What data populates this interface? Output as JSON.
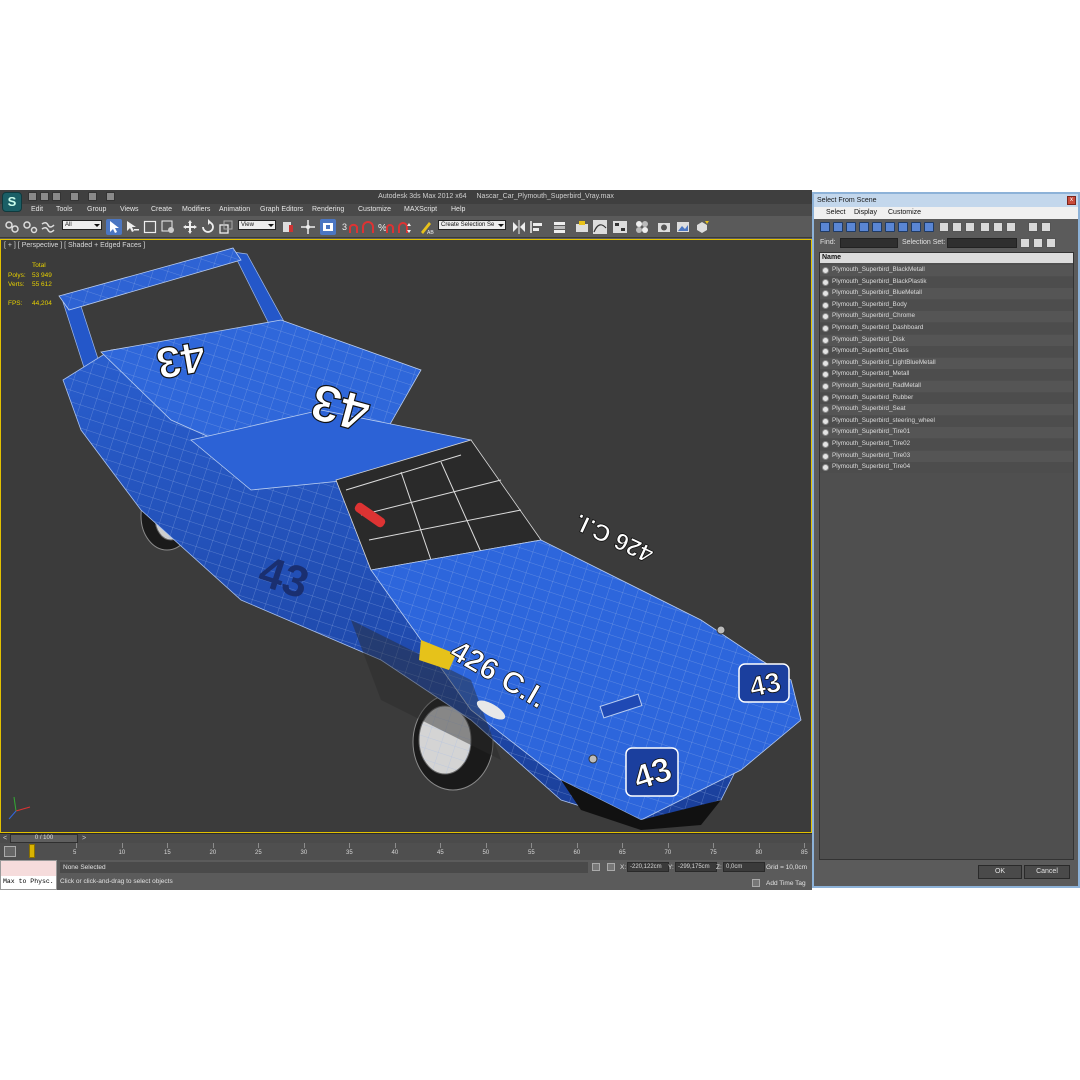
{
  "window": {
    "title": "Autodesk 3ds Max  2012 x64",
    "file": "Nascar_Car_Plymouth_Superbird_Vray.max"
  },
  "menu": [
    "Edit",
    "Tools",
    "Group",
    "Views",
    "Create",
    "Modifiers",
    "Animation",
    "Graph Editors",
    "Rendering",
    "Customize",
    "MAXScript",
    "Help"
  ],
  "toolbar": {
    "filter_value": "All",
    "ref_coord_value": "View",
    "selection_set_placeholder": "Create Selection Se"
  },
  "viewport": {
    "label": "[ + ] [ Perspective ] [ Shaded + Edged Faces ]",
    "stats": {
      "header": "Total",
      "polys_label": "Polys:",
      "polys_value": "53 949",
      "verts_label": "Verts:",
      "verts_value": "55 612",
      "fps_label": "FPS:",
      "fps_value": "44,204"
    },
    "car_texts": {
      "roof_number": "43",
      "wing_number": "43",
      "door_number": "43",
      "hood_text": "426 C.I.",
      "hood_text_mirrored": "426 C.I.",
      "nose_number": "43",
      "front_number": "43"
    }
  },
  "timeline": {
    "position": "0 / 100",
    "prev": "<",
    "next": ">",
    "ticks": [
      "5",
      "10",
      "15",
      "20",
      "25",
      "30",
      "35",
      "40",
      "45",
      "50",
      "55",
      "60",
      "65",
      "70",
      "75",
      "80",
      "85"
    ]
  },
  "status": {
    "maxscript_text": "Max to Physc.",
    "selection": "None Selected",
    "prompt": "Click or click-and-drag to select objects",
    "x_label": "X:",
    "x_value": "-220,122cm",
    "y_label": "Y:",
    "y_value": "-299,175cm",
    "z_label": "Z:",
    "z_value": "0,0cm",
    "grid": "Grid = 10,0cm",
    "add_time_tag": "Add Time Tag"
  },
  "dialog": {
    "title": "Select From Scene",
    "close": "x",
    "menu": [
      "Select",
      "Display",
      "Customize"
    ],
    "find_label": "Find:",
    "selection_sets_label": "Selection Set:",
    "column_name": "Name",
    "items": [
      "Plymouth_Superbird_BlackMetall",
      "Plymouth_Superbird_BlackPlastik",
      "Plymouth_Superbird_BlueMetall",
      "Plymouth_Superbird_Body",
      "Plymouth_Superbird_Chrome",
      "Plymouth_Superbird_Dashboard",
      "Plymouth_Superbird_Disk",
      "Plymouth_Superbird_Glass",
      "Plymouth_Superbird_LightBlueMetall",
      "Plymouth_Superbird_Metall",
      "Plymouth_Superbird_RadMetall",
      "Plymouth_Superbird_Rubber",
      "Plymouth_Superbird_Seat",
      "Plymouth_Superbird_steering_wheel",
      "Plymouth_Superbird_Tire01",
      "Plymouth_Superbird_Tire02",
      "Plymouth_Superbird_Tire03",
      "Plymouth_Superbird_Tire04"
    ],
    "ok": "OK",
    "cancel": "Cancel"
  },
  "colors": {
    "car_blue": "#1f4fbf",
    "viewport_bg": "#3b3b3b",
    "stats_yellow": "#e7d000",
    "active_viewport_border": "#e2c100"
  }
}
